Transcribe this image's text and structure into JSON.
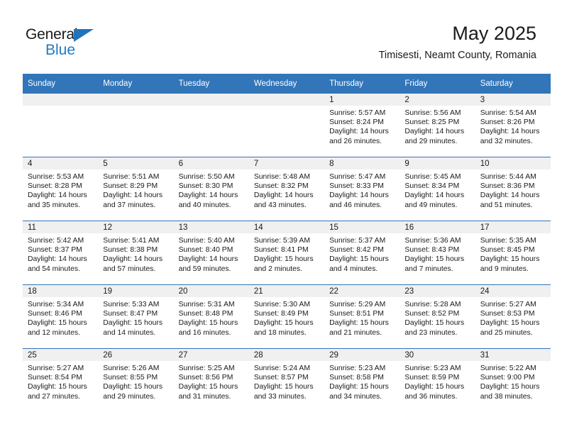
{
  "brand": {
    "name_part1": "General",
    "name_part2": "Blue",
    "accent_color": "#1f7ac4"
  },
  "header": {
    "title": "May 2025",
    "subtitle": "Timisesti, Neamt County, Romania"
  },
  "theme": {
    "header_blue": "#3275b8",
    "daynum_band": "#f0f0f0",
    "text": "#1a1a1a"
  },
  "weekday_headers": [
    "Sunday",
    "Monday",
    "Tuesday",
    "Wednesday",
    "Thursday",
    "Friday",
    "Saturday"
  ],
  "weeks": [
    [
      {
        "day": "",
        "empty": true
      },
      {
        "day": "",
        "empty": true
      },
      {
        "day": "",
        "empty": true
      },
      {
        "day": "",
        "empty": true
      },
      {
        "day": "1",
        "sunrise": "Sunrise: 5:57 AM",
        "sunset": "Sunset: 8:24 PM",
        "daylight": "Daylight: 14 hours and 26 minutes."
      },
      {
        "day": "2",
        "sunrise": "Sunrise: 5:56 AM",
        "sunset": "Sunset: 8:25 PM",
        "daylight": "Daylight: 14 hours and 29 minutes."
      },
      {
        "day": "3",
        "sunrise": "Sunrise: 5:54 AM",
        "sunset": "Sunset: 8:26 PM",
        "daylight": "Daylight: 14 hours and 32 minutes."
      }
    ],
    [
      {
        "day": "4",
        "sunrise": "Sunrise: 5:53 AM",
        "sunset": "Sunset: 8:28 PM",
        "daylight": "Daylight: 14 hours and 35 minutes."
      },
      {
        "day": "5",
        "sunrise": "Sunrise: 5:51 AM",
        "sunset": "Sunset: 8:29 PM",
        "daylight": "Daylight: 14 hours and 37 minutes."
      },
      {
        "day": "6",
        "sunrise": "Sunrise: 5:50 AM",
        "sunset": "Sunset: 8:30 PM",
        "daylight": "Daylight: 14 hours and 40 minutes."
      },
      {
        "day": "7",
        "sunrise": "Sunrise: 5:48 AM",
        "sunset": "Sunset: 8:32 PM",
        "daylight": "Daylight: 14 hours and 43 minutes."
      },
      {
        "day": "8",
        "sunrise": "Sunrise: 5:47 AM",
        "sunset": "Sunset: 8:33 PM",
        "daylight": "Daylight: 14 hours and 46 minutes."
      },
      {
        "day": "9",
        "sunrise": "Sunrise: 5:45 AM",
        "sunset": "Sunset: 8:34 PM",
        "daylight": "Daylight: 14 hours and 49 minutes."
      },
      {
        "day": "10",
        "sunrise": "Sunrise: 5:44 AM",
        "sunset": "Sunset: 8:36 PM",
        "daylight": "Daylight: 14 hours and 51 minutes."
      }
    ],
    [
      {
        "day": "11",
        "sunrise": "Sunrise: 5:42 AM",
        "sunset": "Sunset: 8:37 PM",
        "daylight": "Daylight: 14 hours and 54 minutes."
      },
      {
        "day": "12",
        "sunrise": "Sunrise: 5:41 AM",
        "sunset": "Sunset: 8:38 PM",
        "daylight": "Daylight: 14 hours and 57 minutes."
      },
      {
        "day": "13",
        "sunrise": "Sunrise: 5:40 AM",
        "sunset": "Sunset: 8:40 PM",
        "daylight": "Daylight: 14 hours and 59 minutes."
      },
      {
        "day": "14",
        "sunrise": "Sunrise: 5:39 AM",
        "sunset": "Sunset: 8:41 PM",
        "daylight": "Daylight: 15 hours and 2 minutes."
      },
      {
        "day": "15",
        "sunrise": "Sunrise: 5:37 AM",
        "sunset": "Sunset: 8:42 PM",
        "daylight": "Daylight: 15 hours and 4 minutes."
      },
      {
        "day": "16",
        "sunrise": "Sunrise: 5:36 AM",
        "sunset": "Sunset: 8:43 PM",
        "daylight": "Daylight: 15 hours and 7 minutes."
      },
      {
        "day": "17",
        "sunrise": "Sunrise: 5:35 AM",
        "sunset": "Sunset: 8:45 PM",
        "daylight": "Daylight: 15 hours and 9 minutes."
      }
    ],
    [
      {
        "day": "18",
        "sunrise": "Sunrise: 5:34 AM",
        "sunset": "Sunset: 8:46 PM",
        "daylight": "Daylight: 15 hours and 12 minutes."
      },
      {
        "day": "19",
        "sunrise": "Sunrise: 5:33 AM",
        "sunset": "Sunset: 8:47 PM",
        "daylight": "Daylight: 15 hours and 14 minutes."
      },
      {
        "day": "20",
        "sunrise": "Sunrise: 5:31 AM",
        "sunset": "Sunset: 8:48 PM",
        "daylight": "Daylight: 15 hours and 16 minutes."
      },
      {
        "day": "21",
        "sunrise": "Sunrise: 5:30 AM",
        "sunset": "Sunset: 8:49 PM",
        "daylight": "Daylight: 15 hours and 18 minutes."
      },
      {
        "day": "22",
        "sunrise": "Sunrise: 5:29 AM",
        "sunset": "Sunset: 8:51 PM",
        "daylight": "Daylight: 15 hours and 21 minutes."
      },
      {
        "day": "23",
        "sunrise": "Sunrise: 5:28 AM",
        "sunset": "Sunset: 8:52 PM",
        "daylight": "Daylight: 15 hours and 23 minutes."
      },
      {
        "day": "24",
        "sunrise": "Sunrise: 5:27 AM",
        "sunset": "Sunset: 8:53 PM",
        "daylight": "Daylight: 15 hours and 25 minutes."
      }
    ],
    [
      {
        "day": "25",
        "sunrise": "Sunrise: 5:27 AM",
        "sunset": "Sunset: 8:54 PM",
        "daylight": "Daylight: 15 hours and 27 minutes."
      },
      {
        "day": "26",
        "sunrise": "Sunrise: 5:26 AM",
        "sunset": "Sunset: 8:55 PM",
        "daylight": "Daylight: 15 hours and 29 minutes."
      },
      {
        "day": "27",
        "sunrise": "Sunrise: 5:25 AM",
        "sunset": "Sunset: 8:56 PM",
        "daylight": "Daylight: 15 hours and 31 minutes."
      },
      {
        "day": "28",
        "sunrise": "Sunrise: 5:24 AM",
        "sunset": "Sunset: 8:57 PM",
        "daylight": "Daylight: 15 hours and 33 minutes."
      },
      {
        "day": "29",
        "sunrise": "Sunrise: 5:23 AM",
        "sunset": "Sunset: 8:58 PM",
        "daylight": "Daylight: 15 hours and 34 minutes."
      },
      {
        "day": "30",
        "sunrise": "Sunrise: 5:23 AM",
        "sunset": "Sunset: 8:59 PM",
        "daylight": "Daylight: 15 hours and 36 minutes."
      },
      {
        "day": "31",
        "sunrise": "Sunrise: 5:22 AM",
        "sunset": "Sunset: 9:00 PM",
        "daylight": "Daylight: 15 hours and 38 minutes."
      }
    ]
  ]
}
